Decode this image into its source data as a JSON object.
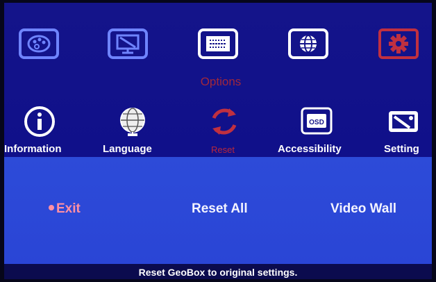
{
  "colors": {
    "background": "#10108a",
    "panel": "#2a45d6",
    "active_accent": "#c03040",
    "inactive_icon": "#6f84ff",
    "status_bar": "#0b0b4e"
  },
  "top_tabs": [
    {
      "icon": "palette-icon",
      "state": "inactive"
    },
    {
      "icon": "monitor-tools-icon",
      "state": "inactive"
    },
    {
      "icon": "options-panel-icon",
      "state": "selected"
    },
    {
      "icon": "globe-panel-icon",
      "state": "inactive"
    },
    {
      "icon": "gear-icon",
      "state": "highlighted"
    }
  ],
  "section_title": "Options",
  "sub_items": [
    {
      "label": "Information",
      "icon": "info-icon"
    },
    {
      "label": "Language",
      "icon": "globe-icon"
    },
    {
      "label": "Reset",
      "icon": "reset-icon",
      "state": "active"
    },
    {
      "label": "Accessibility",
      "icon": "osd-icon"
    },
    {
      "label": "Setting",
      "icon": "settings-tool-icon"
    }
  ],
  "menu": {
    "items": [
      {
        "label": "Exit",
        "selected": true
      },
      {
        "label": "Reset All",
        "selected": false
      },
      {
        "label": "Video Wall",
        "selected": false
      }
    ]
  },
  "status": "Reset GeoBox to original settings."
}
